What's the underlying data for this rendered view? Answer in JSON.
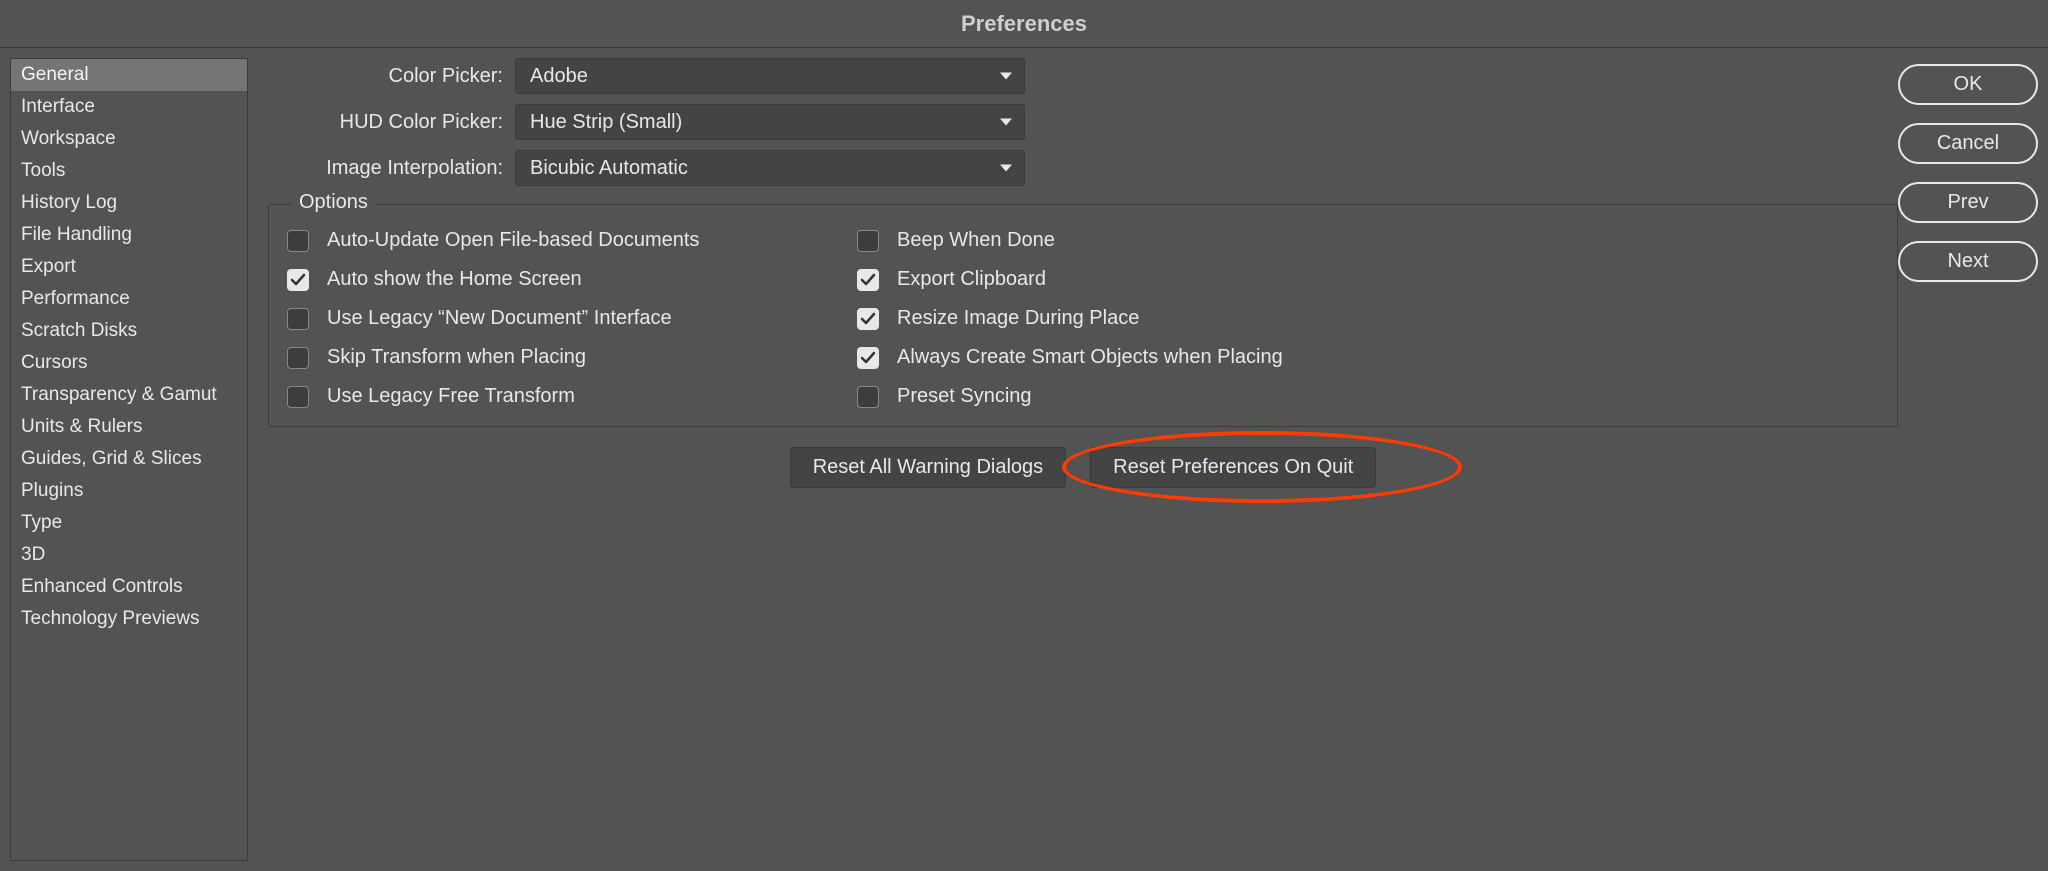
{
  "title": "Preferences",
  "sidebar": {
    "items": [
      {
        "label": "General",
        "selected": true
      },
      {
        "label": "Interface",
        "selected": false
      },
      {
        "label": "Workspace",
        "selected": false
      },
      {
        "label": "Tools",
        "selected": false
      },
      {
        "label": "History Log",
        "selected": false
      },
      {
        "label": "File Handling",
        "selected": false
      },
      {
        "label": "Export",
        "selected": false
      },
      {
        "label": "Performance",
        "selected": false
      },
      {
        "label": "Scratch Disks",
        "selected": false
      },
      {
        "label": "Cursors",
        "selected": false
      },
      {
        "label": "Transparency & Gamut",
        "selected": false
      },
      {
        "label": "Units & Rulers",
        "selected": false
      },
      {
        "label": "Guides, Grid & Slices",
        "selected": false
      },
      {
        "label": "Plugins",
        "selected": false
      },
      {
        "label": "Type",
        "selected": false
      },
      {
        "label": "3D",
        "selected": false
      },
      {
        "label": "Enhanced Controls",
        "selected": false
      },
      {
        "label": "Technology Previews",
        "selected": false
      }
    ]
  },
  "dropdowns": {
    "color_picker": {
      "label": "Color Picker:",
      "value": "Adobe"
    },
    "hud_color_picker": {
      "label": "HUD Color Picker:",
      "value": "Hue Strip (Small)"
    },
    "image_interpolation": {
      "label": "Image Interpolation:",
      "value": "Bicubic Automatic"
    }
  },
  "options": {
    "legend": "Options",
    "items": [
      {
        "label": "Auto-Update Open File-based Documents",
        "checked": false
      },
      {
        "label": "Beep When Done",
        "checked": false
      },
      {
        "label": "Auto show the Home Screen",
        "checked": true
      },
      {
        "label": "Export Clipboard",
        "checked": true
      },
      {
        "label": "Use Legacy “New Document” Interface",
        "checked": false
      },
      {
        "label": "Resize Image During Place",
        "checked": true
      },
      {
        "label": "Skip Transform when Placing",
        "checked": false
      },
      {
        "label": "Always Create Smart Objects when Placing",
        "checked": true
      },
      {
        "label": "Use Legacy Free Transform",
        "checked": false
      },
      {
        "label": "Preset Syncing",
        "checked": false
      }
    ]
  },
  "reset_buttons": {
    "reset_warnings": "Reset All Warning Dialogs",
    "reset_prefs": "Reset Preferences On Quit"
  },
  "actions": {
    "ok": "OK",
    "cancel": "Cancel",
    "prev": "Prev",
    "next": "Next"
  }
}
